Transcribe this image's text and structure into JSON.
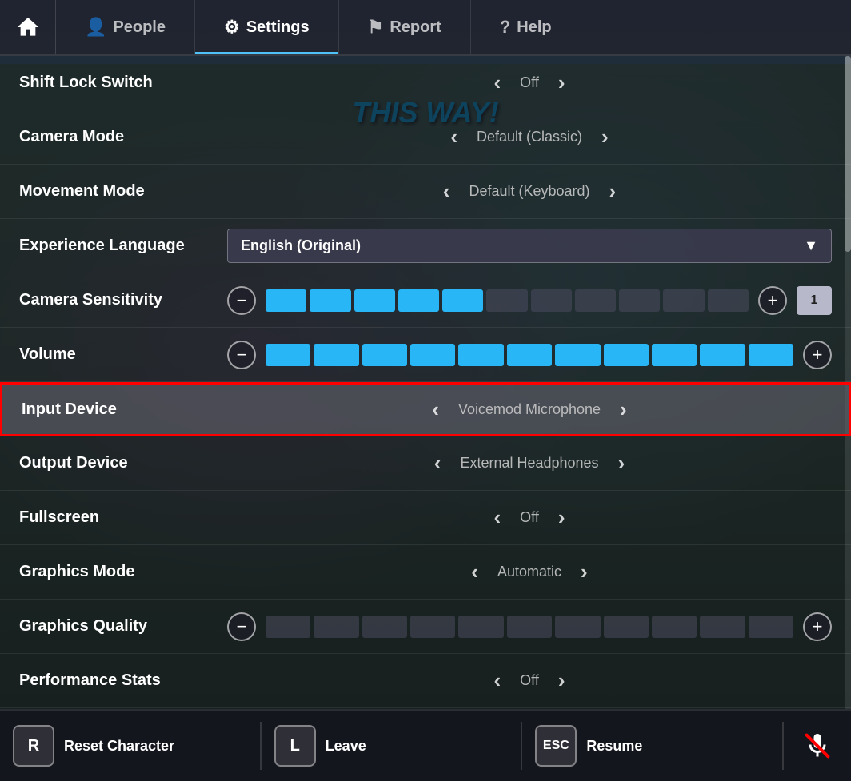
{
  "nav": {
    "home_label": "Home",
    "tabs": [
      {
        "id": "people",
        "label": "People",
        "icon": "👤",
        "active": false
      },
      {
        "id": "settings",
        "label": "Settings",
        "icon": "⚙",
        "active": true
      },
      {
        "id": "report",
        "label": "Report",
        "icon": "⚑",
        "active": false
      },
      {
        "id": "help",
        "label": "Help",
        "icon": "?",
        "active": false
      }
    ]
  },
  "settings": {
    "rows": [
      {
        "id": "shift-lock",
        "label": "Shift Lock Switch",
        "type": "toggle",
        "value": "Off"
      },
      {
        "id": "camera-mode",
        "label": "Camera Mode",
        "type": "toggle",
        "value": "Default (Classic)"
      },
      {
        "id": "movement-mode",
        "label": "Movement Mode",
        "type": "toggle",
        "value": "Default (Keyboard)"
      },
      {
        "id": "experience-language",
        "label": "Experience Language",
        "type": "dropdown",
        "value": "English (Original)"
      },
      {
        "id": "camera-sensitivity",
        "label": "Camera Sensitivity",
        "type": "slider",
        "filled": 5,
        "total": 11,
        "number": "1"
      },
      {
        "id": "volume",
        "label": "Volume",
        "type": "slider",
        "filled": 11,
        "total": 11,
        "showNumber": false
      },
      {
        "id": "input-device",
        "label": "Input Device",
        "type": "toggle",
        "value": "Voicemod Microphone",
        "highlighted": true
      },
      {
        "id": "output-device",
        "label": "Output Device",
        "type": "toggle",
        "value": "External Headphones"
      },
      {
        "id": "fullscreen",
        "label": "Fullscreen",
        "type": "toggle",
        "value": "Off"
      },
      {
        "id": "graphics-mode",
        "label": "Graphics Mode",
        "type": "toggle",
        "value": "Automatic"
      },
      {
        "id": "graphics-quality",
        "label": "Graphics Quality",
        "type": "slider",
        "filled": 0,
        "total": 11,
        "showNumber": false
      },
      {
        "id": "performance-stats",
        "label": "Performance Stats",
        "type": "toggle",
        "value": "Off"
      }
    ]
  },
  "bottom_bar": {
    "actions": [
      {
        "key": "R",
        "label": "Reset Character"
      },
      {
        "key": "L",
        "label": "Leave"
      },
      {
        "key": "ESC",
        "label": "Resume"
      }
    ],
    "mic_label": "Mute microphone"
  },
  "game_text": "THIS WAY!"
}
